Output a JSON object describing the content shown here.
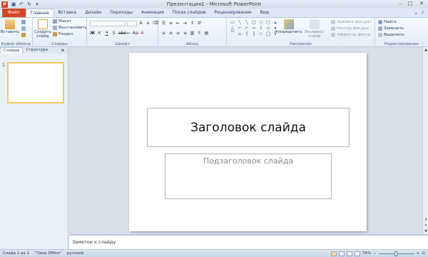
{
  "window": {
    "title": "Презентация1 - Microsoft PowerPoint",
    "app_icon_letter": "P"
  },
  "tabs": [
    {
      "label": "Файл"
    },
    {
      "label": "Главная"
    },
    {
      "label": "Вставка"
    },
    {
      "label": "Дизайн"
    },
    {
      "label": "Переходы"
    },
    {
      "label": "Анимация"
    },
    {
      "label": "Показ слайдов"
    },
    {
      "label": "Рецензирование"
    },
    {
      "label": "Вид"
    }
  ],
  "ribbon": {
    "clipboard": {
      "paste": "Вставить",
      "group": "Буфер обмена"
    },
    "slides": {
      "new_slide": "Создать слайд",
      "layout": "Макет",
      "reset": "Восстановить",
      "section": "Раздел",
      "group": "Слайды"
    },
    "font": {
      "group": "Шрифт"
    },
    "paragraph": {
      "group": "Абзац"
    },
    "drawing": {
      "arrange": "Упорядочить",
      "quick_styles": "Экспресс-стили",
      "fill": "Заливка фигуры",
      "outline": "Контур фигуры",
      "effects": "Эффекты фигур",
      "group": "Рисование"
    },
    "editing": {
      "find": "Найти",
      "replace": "Заменить",
      "select": "Выделить",
      "group": "Редактирование"
    }
  },
  "left_panel": {
    "tab_slides": "Слайды",
    "tab_outline": "Структура",
    "close": "✕",
    "thumb_number": "1"
  },
  "slide": {
    "title_placeholder": "Заголовок слайда",
    "subtitle_placeholder": "Подзаголовок слайда"
  },
  "notes": {
    "placeholder": "Заметки к слайду"
  },
  "status": {
    "slide": "Слайд 1 из 1",
    "theme": "\"Тема Office\"",
    "language": "русский",
    "zoom": "74%"
  }
}
